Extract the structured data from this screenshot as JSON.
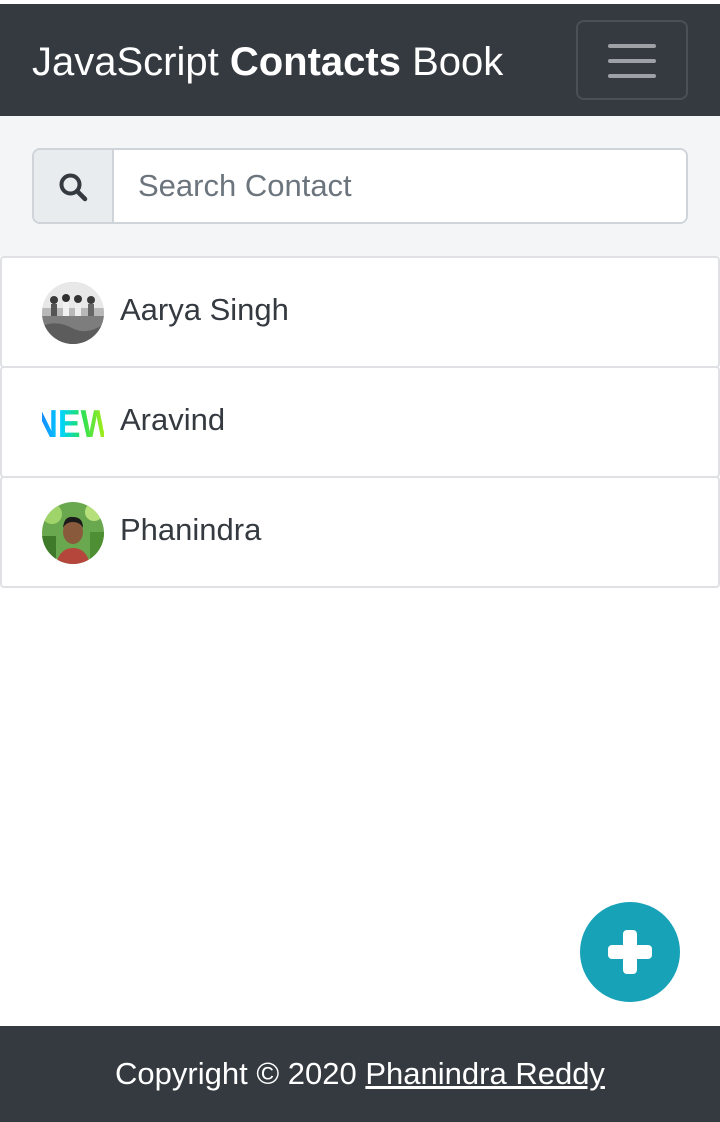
{
  "navbar": {
    "brand_prefix": "JavaScript ",
    "brand_bold": "Contacts",
    "brand_suffix": " Book",
    "menu_icon": "hamburger-menu-icon",
    "bg_color": "#343a40"
  },
  "search": {
    "icon": "search-icon",
    "placeholder": "Search Contact",
    "value": ""
  },
  "contacts": [
    {
      "name": "Aarya Singh",
      "avatar": "group-photo-avatar"
    },
    {
      "name": "Aravind",
      "avatar": "new-text-avatar"
    },
    {
      "name": "Phanindra",
      "avatar": "portrait-photo-avatar"
    }
  ],
  "fab": {
    "icon": "plus-icon",
    "color": "#17a2b8"
  },
  "footer": {
    "text": "Copyright © 2020 ",
    "link": "Phanindra Reddy"
  }
}
